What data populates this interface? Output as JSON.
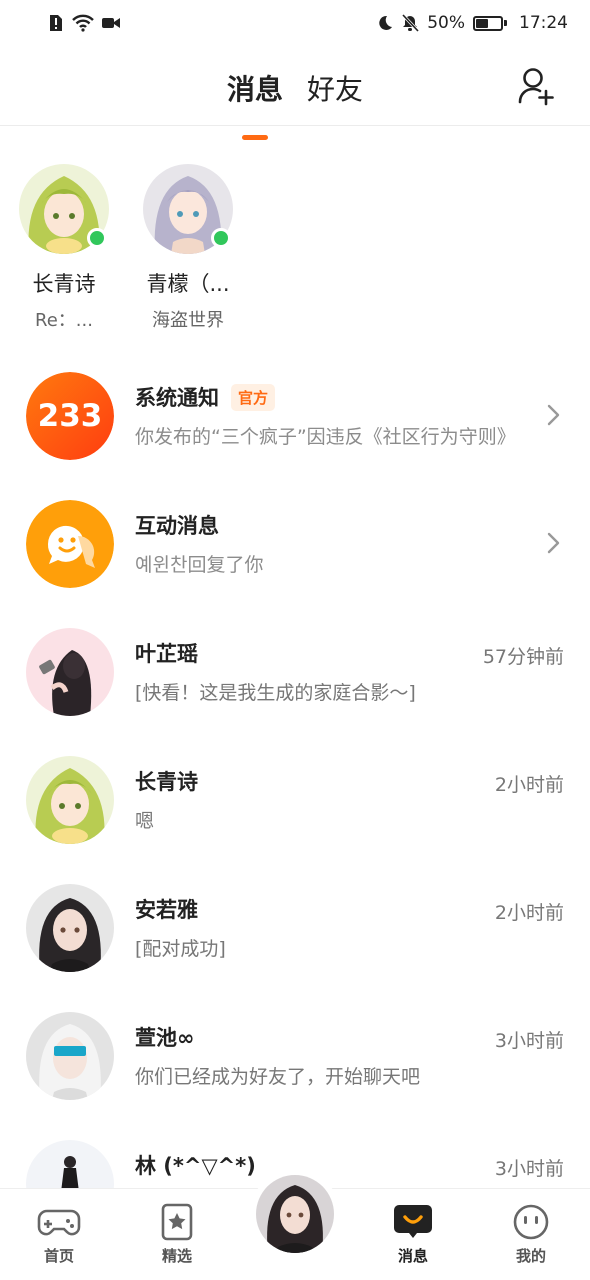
{
  "status_bar": {
    "battery_percent": "50%",
    "time": "17:24",
    "battery_level": 0.5
  },
  "header": {
    "tabs": [
      {
        "label": "消息",
        "active": true
      },
      {
        "label": "好友",
        "active": false
      }
    ],
    "add_friend_icon": "add-friend-icon"
  },
  "online_friends": [
    {
      "name": "长青诗",
      "sub": "Re：...",
      "online": true
    },
    {
      "name": "青檬（...",
      "sub": "海盗世界",
      "online": true
    }
  ],
  "messages": [
    {
      "title": "系统通知",
      "badge": "官方",
      "preview": "你发布的“三个疯子”因违反《社区行为守则》",
      "has_chevron": true,
      "avatar_text": "233"
    },
    {
      "title": "互动消息",
      "preview": "예윈찬回复了你",
      "has_chevron": true
    },
    {
      "title": "叶芷瑶",
      "time": "57分钟前",
      "preview": "[快看！这是我生成的家庭合影～]"
    },
    {
      "title": "长青诗",
      "time": "2小时前",
      "preview": "嗯"
    },
    {
      "title": "安若雅",
      "time": "2小时前",
      "preview": "[配对成功]"
    },
    {
      "title": "萱池∞",
      "time": "3小时前",
      "preview": "你们已经成为好友了，开始聊天吧"
    },
    {
      "title": "林 (*^▽^*)",
      "time": "3小时前",
      "preview": ""
    }
  ],
  "bottom_nav": [
    {
      "label": "首页",
      "icon": "gamepad-icon"
    },
    {
      "label": "精选",
      "icon": "star-bookmark-icon"
    },
    {
      "label": "消息",
      "icon": "message-icon",
      "active": true
    },
    {
      "label": "我的",
      "icon": "face-icon"
    }
  ],
  "colors": {
    "accent": "#ff6a13",
    "online": "#31c75b"
  }
}
